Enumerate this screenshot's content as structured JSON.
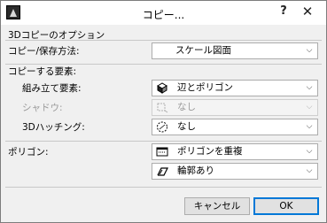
{
  "window": {
    "title": "コピー...",
    "help_label": "?",
    "close_label": "✕"
  },
  "options": {
    "section_label": "3Dコピーのオプション",
    "copy_method": {
      "label": "コピー/保存方法:",
      "value": "スケール図面"
    }
  },
  "elements": {
    "section_label": "コピーする要素:",
    "assembly": {
      "label": "組み立て要素:",
      "value": "辺とポリゴン",
      "icon": "cube-icon"
    },
    "shadow": {
      "label": "シャドウ:",
      "value": "なし",
      "icon": "shadow-icon",
      "disabled": true
    },
    "hatching": {
      "label": "3Dハッチング:",
      "value": "なし",
      "icon": "hatch-circle-icon"
    }
  },
  "polygon": {
    "label": "ポリゴン:",
    "fill": {
      "value": "ポリゴンを重複",
      "icon": "polygon-fill-icon"
    },
    "outline": {
      "value": "輪郭あり",
      "icon": "outline-icon"
    }
  },
  "buttons": {
    "cancel": "キャンセル",
    "ok": "OK"
  },
  "colors": {
    "accent": "#0078d7",
    "window_bg": "#f0f0f0"
  }
}
